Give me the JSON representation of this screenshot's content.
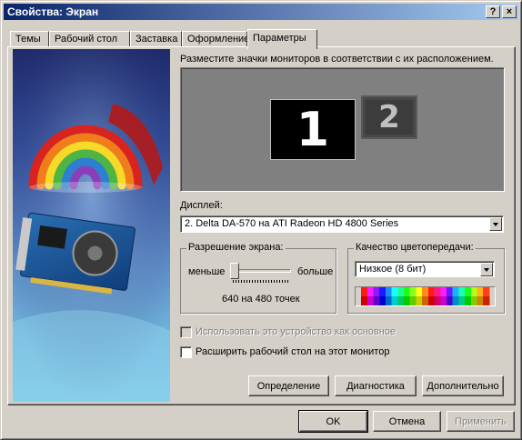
{
  "window": {
    "title": "Свойства: Экран",
    "help_button": "?",
    "close_button": "×"
  },
  "tabs": [
    {
      "label": "Темы",
      "active": false
    },
    {
      "label": "Рабочий стол",
      "active": false
    },
    {
      "label": "Заставка",
      "active": false
    },
    {
      "label": "Оформление",
      "active": false
    },
    {
      "label": "Параметры",
      "active": true
    }
  ],
  "settings": {
    "instruction": "Разместите значки мониторов в соответствии с их расположением.",
    "monitors": [
      {
        "number": "1",
        "selected": true
      },
      {
        "number": "2",
        "selected": false
      }
    ],
    "display_label": "Дисплей:",
    "display_value": "2. Delta DA-570 на ATI Radeon HD 4800 Series",
    "resolution": {
      "title": "Разрешение экрана:",
      "less_label": "меньше",
      "more_label": "больше",
      "value_text": "640 на 480 точек"
    },
    "color_quality": {
      "title": "Качество цветопередачи:",
      "value": "Низкое (8 бит)"
    },
    "checkboxes": [
      {
        "label": "Использовать это устройство как основное",
        "checked": false,
        "enabled": false
      },
      {
        "label": "Расширить рабочий стол на этот монитор",
        "checked": false,
        "enabled": true
      }
    ],
    "buttons": {
      "identify": "Определение",
      "troubleshoot": "Диагностика",
      "advanced": "Дополнительно"
    }
  },
  "footer": {
    "ok": "OK",
    "cancel": "Отмена",
    "apply": "Применить"
  },
  "colors": {
    "titlebar_start": "#0a246a",
    "titlebar_end": "#a6caf0",
    "dialog_face": "#d4d0c8",
    "monitor_area": "#808080"
  }
}
